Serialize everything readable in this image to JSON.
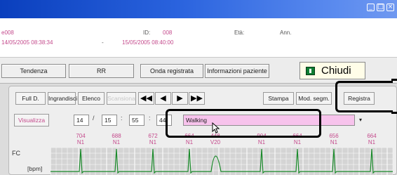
{
  "window": {
    "controls": [
      "minimize-icon",
      "maximize-icon",
      "close-icon"
    ],
    "titlebar_color": "#2a63de"
  },
  "info": {
    "id_value": "e008",
    "start_datetime": "14/05/2005 08:38:34",
    "id_label": "ID:",
    "id_number": "008",
    "end_datetime": "15/05/2005 08:40:00",
    "eta_label": "Età:",
    "eta_unit": "Ann.",
    "range_separator": "-"
  },
  "toolbar": {
    "tendenza": "Tendenza",
    "rr": "RR",
    "onda_registrata": "Onda registrata",
    "informazioni_paziente": "Informazioni paziente",
    "chiudi": "Chiudi"
  },
  "panel": {
    "full_d": "Full D.",
    "ingrandisci": "Ingrandisci",
    "elenco": "Elenco",
    "scansiona": "Scansiona",
    "stampa": "Stampa",
    "mod_segm": "Mod. segm.",
    "registra": "Registra",
    "visualizza": "Visualizza",
    "time_h": "14",
    "time_sep1": "/",
    "time_m": "15",
    "time_sep2": ":",
    "time_mm": "55",
    "time_sep3": ":",
    "time_s": "44",
    "activity_value": "Walking",
    "activity_color": "#f7c3ec",
    "fc_label": "FC",
    "bpm_label": "[bpm]"
  },
  "beats": [
    {
      "rr": "704",
      "type": "N1"
    },
    {
      "rr": "688",
      "type": "N1"
    },
    {
      "rr": "672",
      "type": "N1"
    },
    {
      "rr": "664",
      "type": "N1"
    },
    {
      "rr": "448",
      "type": "V20"
    },
    {
      "rr": "904",
      "type": "N1"
    },
    {
      "rr": "664",
      "type": "N1"
    },
    {
      "rr": "656",
      "type": "N1"
    },
    {
      "rr": "664",
      "type": "N1"
    }
  ],
  "colors": {
    "accent_text": "#c44a8c",
    "ecg_trace": "#1a8a2a",
    "chiudi_bg": "#fffde8"
  }
}
